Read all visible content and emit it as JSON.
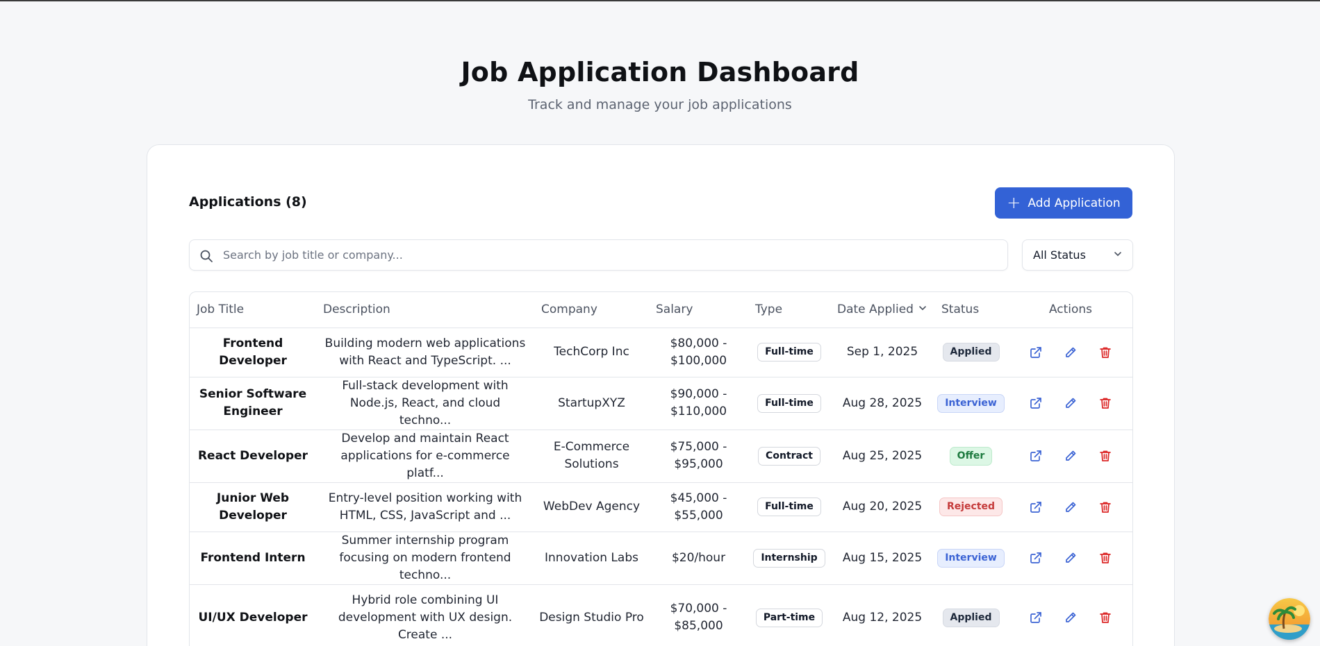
{
  "header": {
    "title": "Job Application Dashboard",
    "subtitle": "Track and manage your job applications"
  },
  "toolbar": {
    "heading": "Applications (8)",
    "add_label": "Add Application",
    "search_placeholder": "Search by job title or company...",
    "status_filter": "All Status"
  },
  "table": {
    "columns": [
      "Job Title",
      "Description",
      "Company",
      "Salary",
      "Type",
      "Date Applied",
      "Status",
      "Actions"
    ],
    "rows": [
      {
        "title": "Frontend Developer",
        "description": "Building modern web applications with React and TypeScript. ...",
        "company": "TechCorp Inc",
        "salary": "$80,000 - $100,000",
        "type": "Full-time",
        "date": "Sep 1, 2025",
        "status": "Applied"
      },
      {
        "title": "Senior Software Engineer",
        "description": "Full-stack development with Node.js, React, and cloud techno...",
        "company": "StartupXYZ",
        "salary": "$90,000 - $110,000",
        "type": "Full-time",
        "date": "Aug 28, 2025",
        "status": "Interview"
      },
      {
        "title": "React Developer",
        "description": "Develop and maintain React applications for e-commerce platf...",
        "company": "E-Commerce Solutions",
        "salary": "$75,000 - $95,000",
        "type": "Contract",
        "date": "Aug 25, 2025",
        "status": "Offer"
      },
      {
        "title": "Junior Web Developer",
        "description": "Entry-level position working with HTML, CSS, JavaScript and ...",
        "company": "WebDev Agency",
        "salary": "$45,000 - $55,000",
        "type": "Full-time",
        "date": "Aug 20, 2025",
        "status": "Rejected"
      },
      {
        "title": "Frontend Intern",
        "description": "Summer internship program focusing on modern frontend techno...",
        "company": "Innovation Labs",
        "salary": "$20/hour",
        "type": "Internship",
        "date": "Aug 15, 2025",
        "status": "Interview"
      },
      {
        "title": "UI/UX Developer",
        "description": "Hybrid role combining UI development with UX design. Create ...",
        "company": "Design Studio Pro",
        "salary": "$70,000 - $85,000",
        "type": "Part-time",
        "date": "Aug 12, 2025",
        "status": "Applied"
      }
    ]
  },
  "icons": {
    "search": "search-icon",
    "chevron": "chevron-down-icon",
    "open": "external-link-icon",
    "edit": "pencil-icon",
    "delete": "trash-icon",
    "assistant": "beach-avatar-icon"
  },
  "colors": {
    "accent": "#3362d6",
    "delete": "#dc2626",
    "action": "#3b63d4"
  }
}
